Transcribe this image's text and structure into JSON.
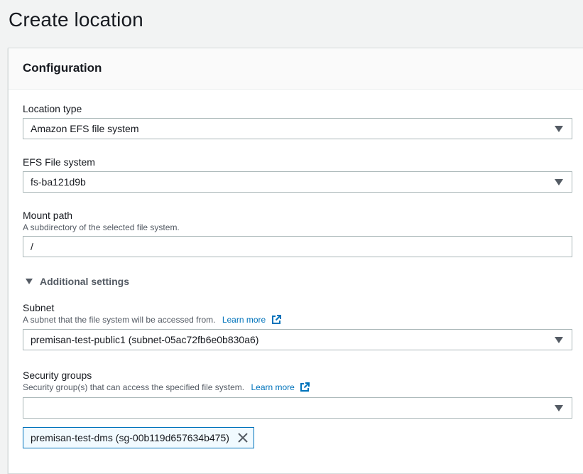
{
  "page": {
    "title": "Create location"
  },
  "panel": {
    "title": "Configuration"
  },
  "location_type": {
    "label": "Location type",
    "value": "Amazon EFS file system"
  },
  "efs_file_system": {
    "label": "EFS File system",
    "value": "fs-ba121d9b"
  },
  "mount_path": {
    "label": "Mount path",
    "description": "A subdirectory of the selected file system.",
    "value": "/"
  },
  "additional_settings": {
    "label": "Additional settings",
    "expanded": true
  },
  "subnet": {
    "label": "Subnet",
    "description": "A subnet that the file system will be accessed from.",
    "learn_more": "Learn more",
    "value": "premisan-test-public1 (subnet-05ac72fb6e0b830a6)"
  },
  "security_groups": {
    "label": "Security groups",
    "description": "Security group(s) that can access the specified file system.",
    "learn_more": "Learn more",
    "value": "",
    "selected_token": "premisan-test-dms (sg-00b119d657634b475)"
  },
  "colors": {
    "link": "#0073bb",
    "token_border": "#0073bb",
    "token_bg": "#f1faff",
    "border": "#aab7b8"
  },
  "icons": {
    "dropdown": "caret-down-icon",
    "external": "external-link-icon",
    "remove": "close-icon",
    "expander": "triangle-down-icon"
  }
}
